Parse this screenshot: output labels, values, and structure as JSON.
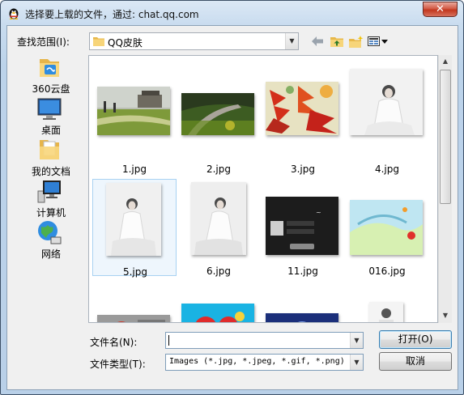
{
  "window": {
    "title": "选择要上载的文件，通过: chat.qq.com",
    "close_label": "✕"
  },
  "look_in": {
    "label": "查找范围(I):",
    "value": "QQ皮肤"
  },
  "toolbar": [
    {
      "name": "back-arrow-icon",
      "glyph": "⇦"
    },
    {
      "name": "up-folder-icon",
      "glyph": ""
    },
    {
      "name": "new-folder-icon",
      "glyph": ""
    },
    {
      "name": "view-menu-icon",
      "glyph": "▾"
    }
  ],
  "places": [
    {
      "label": "360云盘",
      "icon": "cloud-folder-icon"
    },
    {
      "label": "桌面",
      "icon": "desktop-icon"
    },
    {
      "label": "我的文档",
      "icon": "documents-folder-icon"
    },
    {
      "label": "计算机",
      "icon": "computer-icon"
    },
    {
      "label": "网络",
      "icon": "network-globe-icon"
    }
  ],
  "files": [
    {
      "name": "1.jpg"
    },
    {
      "name": "2.jpg"
    },
    {
      "name": "3.jpg"
    },
    {
      "name": "4.jpg"
    },
    {
      "name": "5.jpg"
    },
    {
      "name": "6.jpg"
    },
    {
      "name": "11.jpg"
    },
    {
      "name": "016.jpg"
    }
  ],
  "filename": {
    "label": "文件名(N):",
    "value": ""
  },
  "filetype": {
    "label": "文件类型(T):",
    "value": "Images (*.jpg, *.jpeg, *.gif, *.png)"
  },
  "buttons": {
    "open": "打开(O)",
    "cancel": "取消"
  }
}
